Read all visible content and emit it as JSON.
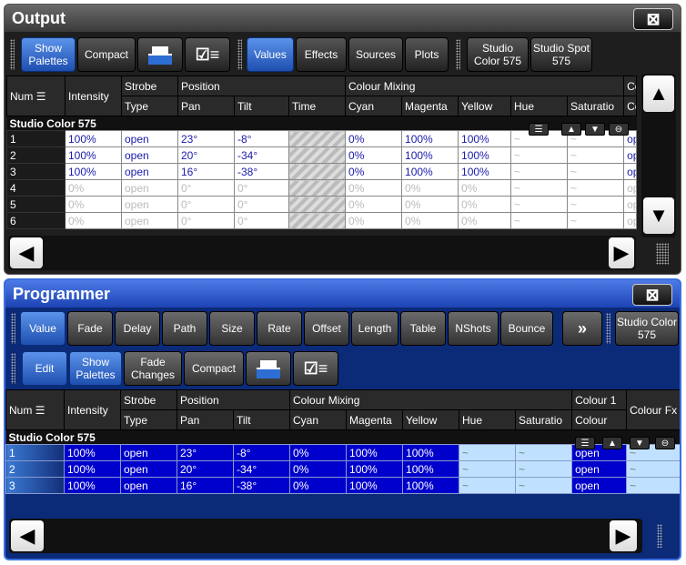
{
  "output": {
    "title": "Output",
    "close": "⊠",
    "buttons": {
      "show_palettes": "Show Palettes",
      "compact": "Compact",
      "values": "Values",
      "effects": "Effects",
      "sources": "Sources",
      "plots": "Plots",
      "studio_color": "Studio Color 575",
      "studio_spot": "Studio Spot 575"
    },
    "headers": {
      "num": "Num",
      "intensity": "Intensity",
      "strobe": "Strobe",
      "type": "Type",
      "position": "Position",
      "pan": "Pan",
      "tilt": "Tilt",
      "time": "Time",
      "colour_mixing": "Colour Mixing",
      "cyan": "Cyan",
      "magenta": "Magenta",
      "yellow": "Yellow",
      "hue": "Hue",
      "saturation": "Saturatio",
      "co1": "Co",
      "co2": "Co"
    },
    "group": "Studio Color 575",
    "rows": [
      {
        "num": "1",
        "intensity": "100%",
        "type": "open",
        "pan": "23°",
        "tilt": "-8°",
        "cyan": "0%",
        "magenta": "100%",
        "yellow": "100%",
        "hue": "~",
        "sat": "~",
        "co": "ope"
      },
      {
        "num": "2",
        "intensity": "100%",
        "type": "open",
        "pan": "20°",
        "tilt": "-34°",
        "cyan": "0%",
        "magenta": "100%",
        "yellow": "100%",
        "hue": "~",
        "sat": "~",
        "co": "ope"
      },
      {
        "num": "3",
        "intensity": "100%",
        "type": "open",
        "pan": "16°",
        "tilt": "-38°",
        "cyan": "0%",
        "magenta": "100%",
        "yellow": "100%",
        "hue": "~",
        "sat": "~",
        "co": "ope"
      },
      {
        "num": "4",
        "intensity": "0%",
        "type": "open",
        "pan": "0°",
        "tilt": "0°",
        "cyan": "0%",
        "magenta": "0%",
        "yellow": "0%",
        "hue": "~",
        "sat": "~",
        "co": "op"
      },
      {
        "num": "5",
        "intensity": "0%",
        "type": "open",
        "pan": "0°",
        "tilt": "0°",
        "cyan": "0%",
        "magenta": "0%",
        "yellow": "0%",
        "hue": "~",
        "sat": "~",
        "co": "op"
      },
      {
        "num": "6",
        "intensity": "0%",
        "type": "open",
        "pan": "0°",
        "tilt": "0°",
        "cyan": "0%",
        "magenta": "0%",
        "yellow": "0%",
        "hue": "~",
        "sat": "~",
        "co": "op"
      }
    ]
  },
  "programmer": {
    "title": "Programmer",
    "close": "⊠",
    "tabs": [
      "Value",
      "Fade",
      "Delay",
      "Path",
      "Size",
      "Rate",
      "Offset",
      "Length",
      "Table",
      "NShots",
      "Bounce"
    ],
    "more": "»",
    "studio_color": "Studio Color 575",
    "buttons": {
      "edit": "Edit",
      "show_palettes": "Show Palettes",
      "fade_changes": "Fade Changes",
      "compact": "Compact"
    },
    "headers": {
      "num": "Num",
      "intensity": "Intensity",
      "strobe": "Strobe",
      "type": "Type",
      "position": "Position",
      "pan": "Pan",
      "tilt": "Tilt",
      "colour_mixing": "Colour Mixing",
      "cyan": "Cyan",
      "magenta": "Magenta",
      "yellow": "Yellow",
      "hue": "Hue",
      "saturation": "Saturatio",
      "colour1": "Colour 1",
      "colour": "Colour",
      "colourfx": "Colour Fx"
    },
    "group": "Studio Color 575",
    "rows": [
      {
        "num": "1",
        "intensity": "100%",
        "type": "open",
        "pan": "23°",
        "tilt": "-8°",
        "cyan": "0%",
        "magenta": "100%",
        "yellow": "100%",
        "hue": "~",
        "sat": "~",
        "colour": "open",
        "fx": "~"
      },
      {
        "num": "2",
        "intensity": "100%",
        "type": "open",
        "pan": "20°",
        "tilt": "-34°",
        "cyan": "0%",
        "magenta": "100%",
        "yellow": "100%",
        "hue": "~",
        "sat": "~",
        "colour": "open",
        "fx": "~"
      },
      {
        "num": "3",
        "intensity": "100%",
        "type": "open",
        "pan": "16°",
        "tilt": "-38°",
        "cyan": "0%",
        "magenta": "100%",
        "yellow": "100%",
        "hue": "~",
        "sat": "~",
        "colour": "open",
        "fx": "~"
      }
    ]
  }
}
